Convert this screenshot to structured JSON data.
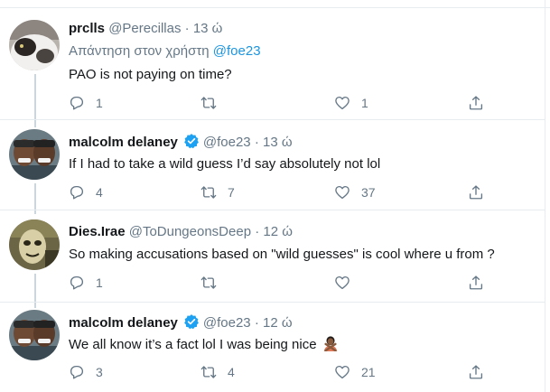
{
  "tweets": [
    {
      "name": "prclls",
      "handle": "@Perecillas",
      "dot": "·",
      "time": "13 ώ",
      "reply_prefix": "Απάντηση στον χρήστη",
      "reply_mention": "@foe23",
      "text": "PAO is not paying on time?",
      "replies": "1",
      "retweets": "",
      "likes": "1",
      "verified": false
    },
    {
      "name": "malcolm delaney",
      "handle": "@foe23",
      "dot": "·",
      "time": "13 ώ",
      "text": "If I had to take a wild guess I’d say absolutely not lol",
      "replies": "4",
      "retweets": "7",
      "likes": "37",
      "verified": true
    },
    {
      "name": "Dies.Irae",
      "handle": "@ToDungeonsDeep",
      "dot": "·",
      "time": "12 ώ",
      "text": "So making accusations based on \"wild guesses\" is cool where u from ?",
      "replies": "1",
      "retweets": "",
      "likes": "",
      "verified": false
    },
    {
      "name": "malcolm delaney",
      "handle": "@foe23",
      "dot": "·",
      "time": "12 ώ",
      "text": "We all know it’s a fact lol I was being nice",
      "emoji": "person-gesturing-no-emoji",
      "replies": "3",
      "retweets": "4",
      "likes": "21",
      "verified": true
    }
  ],
  "icons": {
    "reply": "reply-icon",
    "retweet": "retweet-icon",
    "like": "heart-icon",
    "share": "share-icon",
    "verified": "verified-badge-icon"
  },
  "colors": {
    "text": "#14171a",
    "secondary": "#657786",
    "link": "#1b95e0",
    "verified": "#1da1f2",
    "border": "#e6ecf0",
    "thread_line": "#ccd6dd"
  }
}
